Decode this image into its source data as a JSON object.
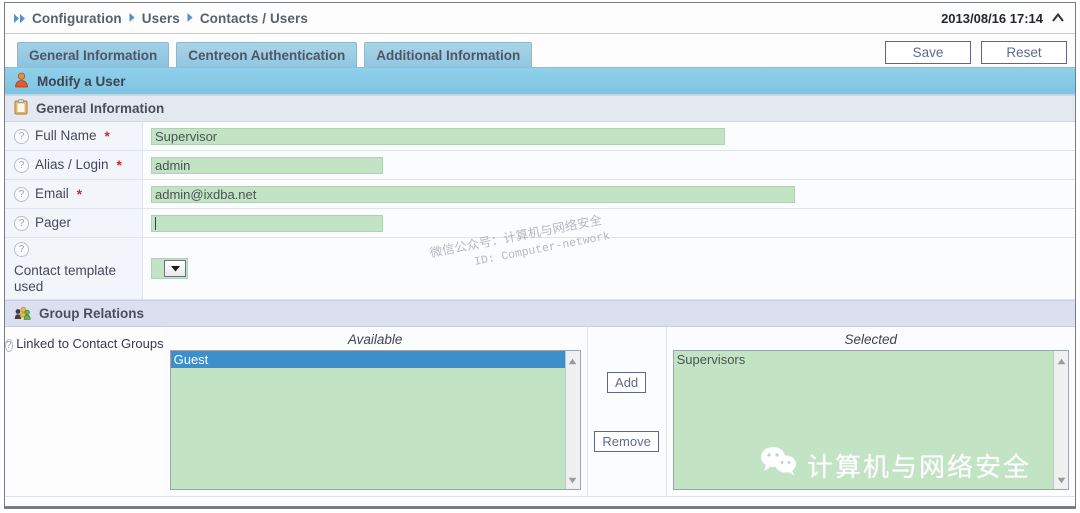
{
  "breadcrumb": {
    "items": [
      "Configuration",
      "Users",
      "Contacts / Users"
    ],
    "timestamp": "2013/08/16 17:14"
  },
  "tabs": [
    {
      "label": "General Information",
      "active": true
    },
    {
      "label": "Centreon Authentication",
      "active": false
    },
    {
      "label": "Additional Information",
      "active": false
    }
  ],
  "toolbar": {
    "save_label": "Save",
    "reset_label": "Reset"
  },
  "page": {
    "title": "Modify a User",
    "section_general": "General Information",
    "section_group": "Group Relations"
  },
  "form": {
    "fields": [
      {
        "label": "Full Name",
        "required": "*",
        "value": "Supervisor"
      },
      {
        "label": "Alias / Login",
        "required": "*",
        "value": "admin"
      },
      {
        "label": "Email",
        "required": "*",
        "value": "admin@ixdba.net"
      },
      {
        "label": "Pager",
        "required": "",
        "value": ""
      }
    ],
    "contact_template": {
      "label": "Contact template used",
      "value": ""
    }
  },
  "group_relations": {
    "label": "Linked to Contact Groups",
    "available_title": "Available",
    "selected_title": "Selected",
    "available_items": [
      "Guest"
    ],
    "selected_items": [
      "Supervisors"
    ],
    "add_label": "Add",
    "remove_label": "Remove"
  },
  "watermark": {
    "line1": "微信公众号：计算机与网络安全",
    "line2": "ID: Computer-network",
    "logo_text": "计算机与网络安全"
  }
}
